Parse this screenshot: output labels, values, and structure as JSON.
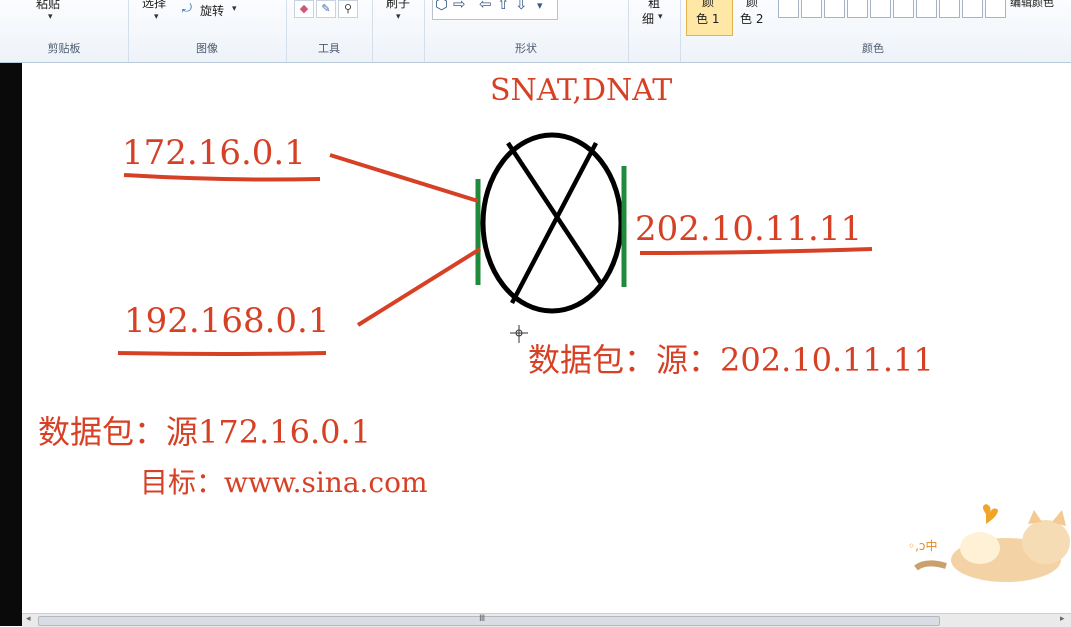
{
  "ribbon": {
    "paste_label": "粘贴",
    "select_label": "选择",
    "rotate_label": "旋转",
    "brushes_label": "刷子",
    "size_label_1": "粗",
    "size_label_2": "细",
    "color1_label_1": "颜",
    "color1_label_2": "色 1",
    "color2_label_1": "颜",
    "color2_label_2": "色 2",
    "edit_colors_label": "编辑颜色",
    "groups": {
      "clipboard": "剪贴板",
      "image": "图像",
      "tools": "工具",
      "shapes": "形状",
      "colors": "颜色"
    }
  },
  "canvas": {
    "title": "SNAT,DNAT",
    "ip_top_left": "172.16.0.1",
    "ip_bottom_left": "192.168.0.1",
    "ip_right": "202.10.11.11",
    "packet_right": "数据包：源：202.10.11.11",
    "packet_left_source": "数据包：源172.16.0.1",
    "packet_left_target": "目标：www.sina.com",
    "mascot_text": "◦,ↄ中"
  },
  "colors": {
    "ink_red": "#d64126",
    "ink_green": "#1f8a3a",
    "ink_black": "#000000"
  },
  "scrollbar": {
    "grip": "Ⅲ"
  }
}
